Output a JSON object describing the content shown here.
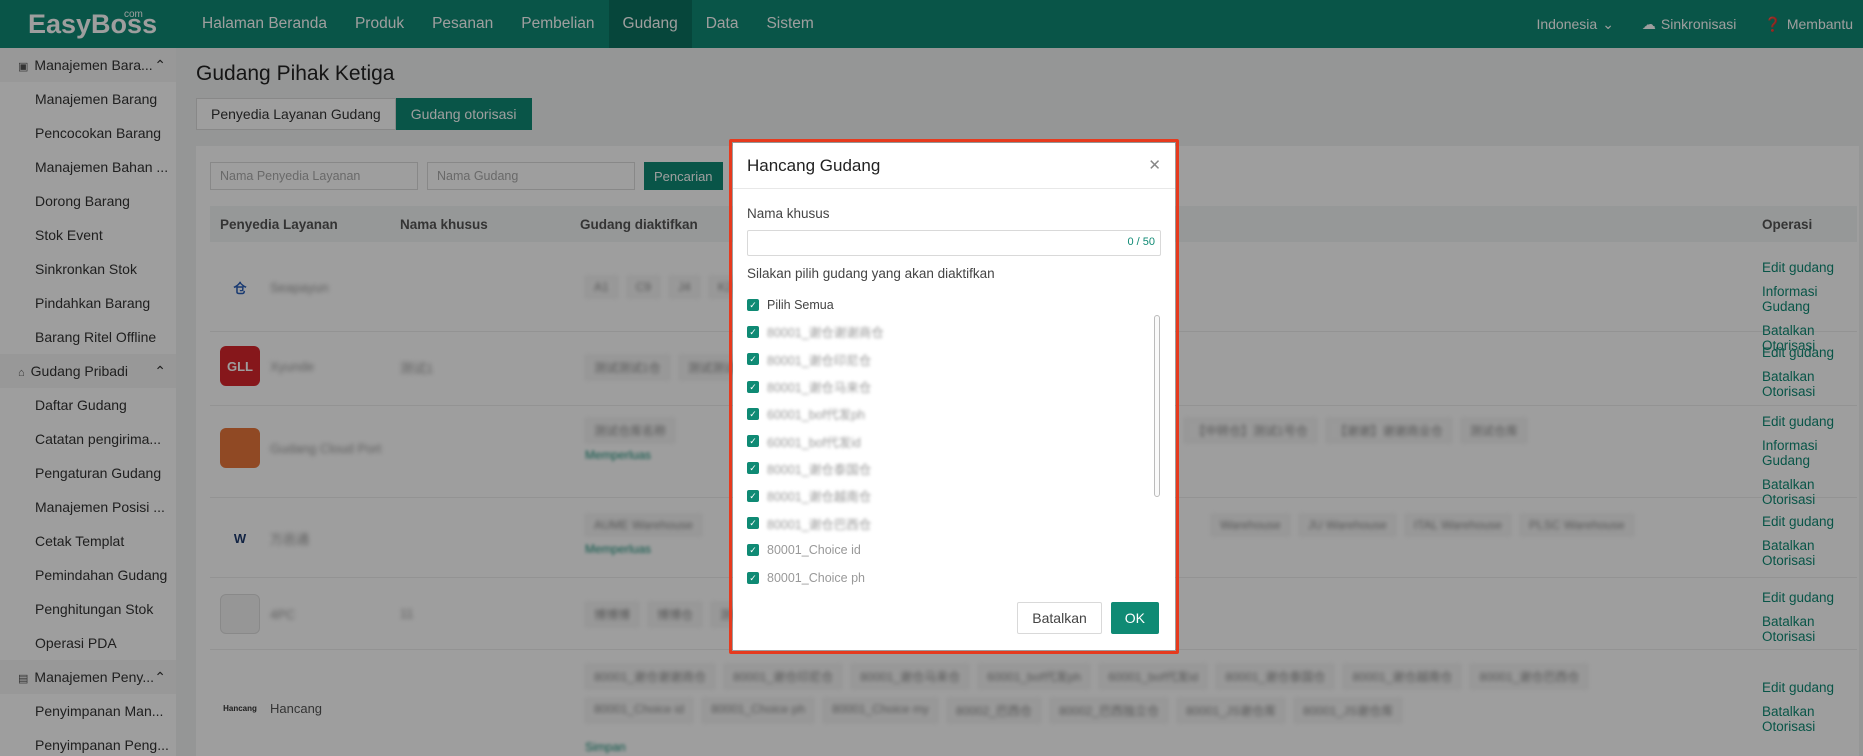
{
  "app": {
    "logo": "EasyBoss",
    "logo_sup": "com"
  },
  "nav": [
    "Halaman Beranda",
    "Produk",
    "Pesanan",
    "Pembelian",
    "Gudang",
    "Data",
    "Sistem"
  ],
  "top_right": {
    "language": "Indonesia",
    "sync": "Sinkronisasi",
    "help": "Membantu"
  },
  "sidebar": {
    "group1": "Manajemen Bara...",
    "group1_items": [
      "Manajemen Barang",
      "Pencocokan Barang",
      "Manajemen Bahan ...",
      "Dorong Barang",
      "Stok Event",
      "Sinkronkan Stok",
      "Pindahkan Barang",
      "Barang Ritel Offline"
    ],
    "group2": "Gudang Pribadi",
    "group2_items": [
      "Daftar Gudang",
      "Catatan pengirima...",
      "Pengaturan Gudang",
      "Manajemen Posisi ...",
      "Cetak Templat",
      "Pemindahan Gudang",
      "Penghitungan Stok",
      "Operasi PDA"
    ],
    "group3": "Manajemen Peny...",
    "group3_items": [
      "Penyimpanan Man...",
      "Penyimpanan Peng..."
    ]
  },
  "page": {
    "title": "Gudang Pihak Ketiga",
    "tabs": [
      "Penyedia Layanan Gudang",
      "Gudang otorisasi"
    ],
    "filter": {
      "provider_placeholder": "Nama Penyedia Layanan",
      "warehouse_placeholder": "Nama Gudang",
      "search": "Pencarian"
    },
    "columns": [
      "Penyedia Layanan",
      "Nama khusus",
      "Gudang diaktifkan",
      "Operasi"
    ],
    "rows": [
      {
        "provider": "Seapayun",
        "logo": "仓",
        "alias": "",
        "ops": [
          "Edit gudang",
          "Informasi Gudang",
          "Batalkan Otorisasi"
        ]
      },
      {
        "provider": "Xyunde",
        "logo": "GLL",
        "alias": "测试1",
        "ops": [
          "Edit gudang",
          "Batalkan Otorisasi"
        ]
      },
      {
        "provider": "Gudang Cloud Port",
        "logo": "",
        "alias": "",
        "more": "Memperluas",
        "ops": [
          "Edit gudang",
          "Informasi Gudang",
          "Batalkan Otorisasi"
        ]
      },
      {
        "provider": "万邑通",
        "logo": "W",
        "alias": "",
        "more": "Memperluas",
        "ops": [
          "Edit gudang",
          "Batalkan Otorisasi"
        ]
      },
      {
        "provider": "4PC",
        "logo": "",
        "alias": "11",
        "ops": [
          "Edit gudang",
          "Batalkan Otorisasi"
        ]
      },
      {
        "provider": "Hancang",
        "logo": "Hancang",
        "alias": "",
        "more": "Simpan",
        "ops": [
          "Edit gudang",
          "Batalkan Otorisasi"
        ]
      }
    ]
  },
  "modal": {
    "title": "Hancang Gudang",
    "alias_label": "Nama khusus",
    "alias_counter": "0 / 50",
    "select_label": "Silakan pilih gudang yang akan diaktifkan",
    "select_all": "Pilih Semua",
    "warehouses": [
      "80001_谢仓谢谢商仓",
      "80001_谢仓印尼仓",
      "80001_谢仓马来仓",
      "60001_bof代发ph",
      "60001_bof代发id",
      "80001_谢仓泰国仓",
      "80001_谢仓越南仓",
      "80001_谢仓巴西仓",
      "80001_Choice id",
      "80001_Choice ph"
    ],
    "cancel": "Batalkan",
    "ok": "OK"
  },
  "colors": {
    "brand": "#0f8a74",
    "highlight": "#e63a1e"
  }
}
